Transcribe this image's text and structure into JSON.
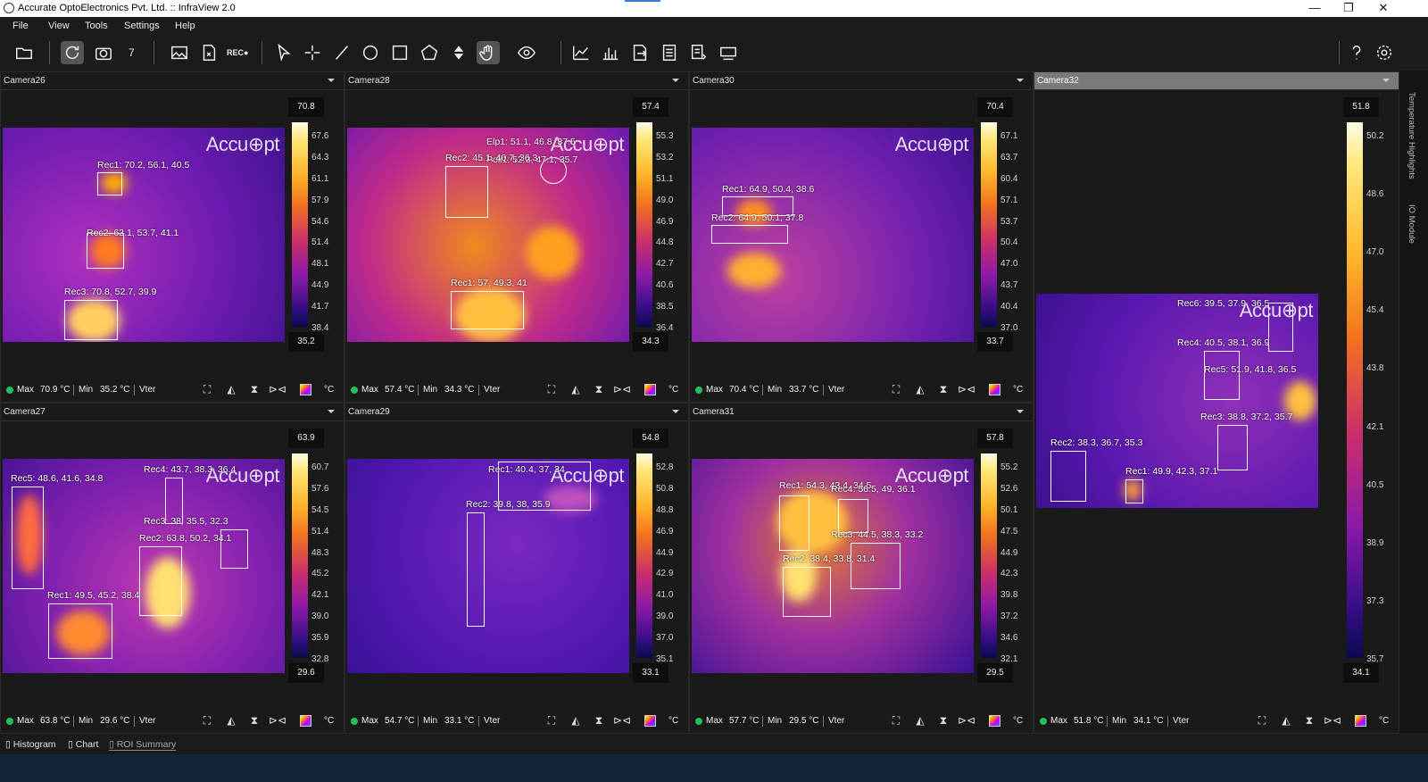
{
  "window": {
    "title": "Accurate OptoElectronics Pvt. Ltd. :: InfraView 2.0",
    "controls": [
      "—",
      "❐",
      "✕"
    ]
  },
  "menu": [
    "File",
    "View",
    "Tools",
    "Settings",
    "Help"
  ],
  "toolbar": {
    "snapshot_count": "7",
    "rec_label": "REC●",
    "icons": [
      "open-folder-icon",
      "refresh-icon",
      "camera-icon",
      "image-icon",
      "export-icon",
      "record-icon",
      "pointer-icon",
      "crosshair-icon",
      "line-icon",
      "ellipse-icon",
      "rectangle-icon",
      "polygon-icon",
      "updown-icon",
      "hand-icon",
      "eye-icon",
      "line-chart-icon",
      "bar-chart-icon",
      "report-export-icon",
      "report-icon",
      "report-config-icon",
      "display-icon",
      "help-icon",
      "settings-icon"
    ]
  },
  "watermark": "Accu⊕pt",
  "cameras": [
    {
      "name": "Camera26",
      "scale_max": "70.8",
      "scale_min": "35.2",
      "ticks": [
        "67.6",
        "64.3",
        "61.1",
        "57.9",
        "54.6",
        "51.4",
        "48.1",
        "44.9",
        "41.7",
        "38.4"
      ],
      "max": "70.9 °C",
      "min": "35.2 °C",
      "rois": [
        "Rec1:  70.2, 56.1, 40.5",
        "Rec2:  63.1, 53.7, 41.1",
        "Rec3:  70.8, 52.7, 39.9"
      ]
    },
    {
      "name": "Camera28",
      "scale_max": "57.4",
      "scale_min": "34.3",
      "ticks": [
        "55.3",
        "53.2",
        "51.1",
        "49.0",
        "46.9",
        "44.8",
        "42.7",
        "40.6",
        "38.5",
        "36.4"
      ],
      "max": "57.4 °C",
      "min": "34.3 °C",
      "rois": [
        "Elp1:  51.1, 46.8, 37.5",
        "Poli1:  52.3, 47.1, 35.7",
        "Rec2:  45.1, 40.7, 36.3",
        "Rec1:  57, 49.3, 41"
      ]
    },
    {
      "name": "Camera30",
      "scale_max": "70.4",
      "scale_min": "33.7",
      "ticks": [
        "67.1",
        "63.7",
        "60.4",
        "57.1",
        "53.7",
        "50.4",
        "47.0",
        "43.7",
        "40.4",
        "37.0"
      ],
      "max": "70.4 °C",
      "min": "33.7 °C",
      "rois": [
        "Rec1:  64.9, 50.4, 38.6",
        "Rec2:  64.9, 50.1, 37.8"
      ]
    },
    {
      "name": "Camera32",
      "scale_max": "51.8",
      "scale_min": "34.1",
      "ticks": [
        "50.2",
        "48.6",
        "47.0",
        "45.4",
        "43.8",
        "42.1",
        "40.5",
        "38.9",
        "37.3",
        "35.7"
      ],
      "max": "51.8 °C",
      "min": "34.1 °C",
      "rois": [
        "Rec6:  39.5, 37.9, 36.5",
        "Rec4:  40.5, 38.1, 36.9",
        "Rec5:  51.9, 41.8, 36.5",
        "Rec3:  38.8, 37.2, 35.7",
        "Rec2:  38.3, 36.7, 35.3",
        "Rec1:  49.9, 42.3, 37.1"
      ]
    },
    {
      "name": "Camera27",
      "scale_max": "63.9",
      "scale_min": "29.6",
      "ticks": [
        "60.7",
        "57.6",
        "54.5",
        "51.4",
        "48.3",
        "45.2",
        "42.1",
        "39.0",
        "35.9",
        "32.8"
      ],
      "max": "63.8 °C",
      "min": "29.6 °C",
      "rois": [
        "Rec5:  48.6, 41.6, 34.8",
        "Rec4:  43.7, 38.3, 36.4",
        "Rec3:  38, 35.5, 32.3",
        "Rec2:  63.8, 50.2, 34.1",
        "Rec1:  49.5, 45.2, 38.4"
      ]
    },
    {
      "name": "Camera29",
      "scale_max": "54.8",
      "scale_min": "33.1",
      "ticks": [
        "52.8",
        "50.8",
        "48.8",
        "46.9",
        "44.9",
        "42.9",
        "41.0",
        "39.0",
        "37.0",
        "35.1"
      ],
      "max": "54.7 °C",
      "min": "33.1 °C",
      "rois": [
        "Rec1:  40.4, 37, 34",
        "Rec2:  39.8, 38, 35.9"
      ]
    },
    {
      "name": "Camera31",
      "scale_max": "57.8",
      "scale_min": "29.5",
      "ticks": [
        "55.2",
        "52.6",
        "50.1",
        "47.5",
        "44.9",
        "42.3",
        "39.8",
        "37.2",
        "34.6",
        "32.1"
      ],
      "max": "57.7 °C",
      "min": "29.5 °C",
      "rois": [
        "Rec1:  54.3, 43.4, 34.5",
        "Rec4:  56.5, 49, 36.1",
        "Rec3:  44.5, 38.3, 33.2",
        "Rec2:  38.4, 33.8, 31.4"
      ]
    }
  ],
  "footer_labels": {
    "max": "Max",
    "min": "Min",
    "vter": "Vter",
    "unit": "°C"
  },
  "right_strip": [
    "Temperature Highlights",
    "IO Module"
  ],
  "bottom_tabs": [
    "Histogram",
    "Chart",
    "ROI Summary"
  ],
  "status_colors": {
    "live": "#22c05a",
    "selected_header": "#7a7a7a"
  }
}
